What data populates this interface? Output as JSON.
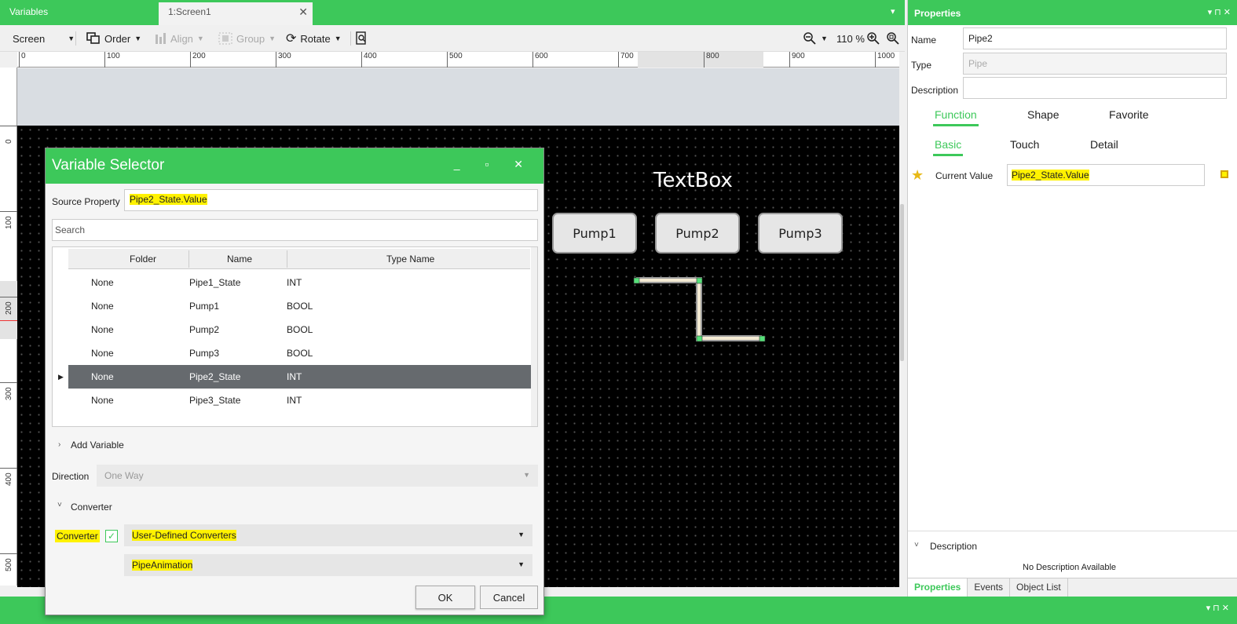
{
  "doc_tabs": {
    "variables": "Variables",
    "screen": "1:Screen1",
    "close": "✕",
    "menu": "▾"
  },
  "toolbar": {
    "screen": "Screen",
    "order": "Order",
    "align": "Align",
    "group": "Group",
    "rotate": "Rotate",
    "zoom": "110 %"
  },
  "ruler_h": [
    "0",
    "100",
    "200",
    "300",
    "400",
    "500",
    "600",
    "700",
    "800",
    "900",
    "1000"
  ],
  "ruler_v": [
    "0",
    "100",
    "200",
    "300",
    "400",
    "500"
  ],
  "canvas": {
    "textbox": "TextBox",
    "pumps": [
      "Pump1",
      "Pump2",
      "Pump3"
    ]
  },
  "dialog": {
    "title": "Variable Selector",
    "controls": "_ ▫ ✕",
    "source_label": "Source Property",
    "source_value": "Pipe2_State.Value",
    "search_placeholder": "Search",
    "columns": [
      "Folder",
      "Name",
      "Type Name"
    ],
    "rows": [
      {
        "folder": "None",
        "name": "Pipe1_State",
        "type": "INT"
      },
      {
        "folder": "None",
        "name": "Pump1",
        "type": "BOOL"
      },
      {
        "folder": "None",
        "name": "Pump2",
        "type": "BOOL"
      },
      {
        "folder": "None",
        "name": "Pump3",
        "type": "BOOL"
      },
      {
        "folder": "None",
        "name": "Pipe2_State",
        "type": "INT"
      },
      {
        "folder": "None",
        "name": "Pipe3_State",
        "type": "INT"
      }
    ],
    "add_variable": "Add Variable",
    "direction_label": "Direction",
    "direction_value": "One Way",
    "converter_section": "Converter",
    "converter_label": "Converter",
    "converter_type": "User-Defined Converters",
    "converter_name": "PipeAnimation",
    "ok": "OK",
    "cancel": "Cancel"
  },
  "properties": {
    "title": "Properties",
    "controls": "▾ ⊓ ✕",
    "name_label": "Name",
    "name_value": "Pipe2",
    "type_label": "Type",
    "type_value": "Pipe",
    "desc_label": "Description",
    "tabs1": [
      "Function",
      "Shape",
      "Favorite"
    ],
    "tabs2": [
      "Basic",
      "Touch",
      "Detail"
    ],
    "current_value_label": "Current Value",
    "current_value": "Pipe2_State.Value",
    "desc_section": "Description",
    "no_desc": "No Description Available",
    "bottom_tabs": [
      "Properties",
      "Events",
      "Object List"
    ]
  },
  "bottom": {
    "controls": "▾ ⊓ ✕"
  },
  "colors": {
    "accent": "#3dc85a",
    "highlight": "#fff200"
  }
}
